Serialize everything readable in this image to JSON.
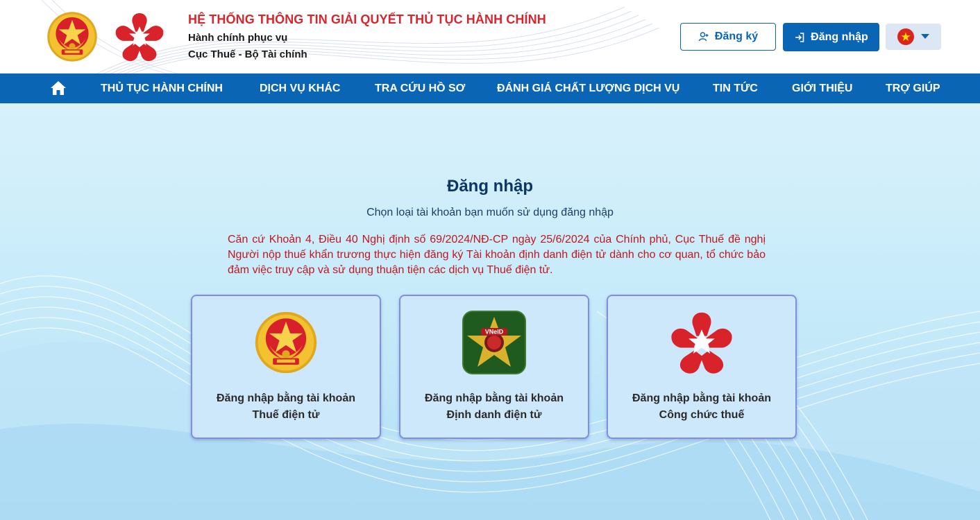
{
  "header": {
    "system_title": "HỆ THỐNG THÔNG TIN GIẢI QUYẾT THỦ TỤC HÀNH CHÍNH",
    "subtitle_line1": "Hành chính phục vụ",
    "subtitle_line2": "Cục Thuế - Bộ Tài chính",
    "register_label": "Đăng ký",
    "login_label": "Đăng nhập",
    "language_icon": "vietnam-flag-icon"
  },
  "nav": {
    "home_icon": "home-icon",
    "items": [
      {
        "label": "THỦ TỤC HÀNH CHÍNH"
      },
      {
        "label": "DỊCH VỤ KHÁC"
      },
      {
        "label": "TRA CỨU HỒ SƠ"
      },
      {
        "label": "ĐÁNH GIÁ CHẤT LƯỢNG DỊCH VỤ"
      },
      {
        "label": "TIN TỨC"
      },
      {
        "label": "GIỚI THIỆU"
      },
      {
        "label": "TRỢ GIÚP"
      }
    ]
  },
  "login": {
    "title": "Đăng nhập",
    "subtitle": "Chọn loại tài khoản bạn muốn sử dụng đăng nhập",
    "notice": "Căn cứ Khoản 4, Điều 40 Nghị định số 69/2024/NĐ-CP ngày 25/6/2024 của Chính phủ, Cục Thuế đề nghị Người nộp thuế khẩn trương thực hiện đăng ký Tài khoản định danh điện tử dành cho cơ quan, tổ chức bảo đảm việc truy cập và sử dụng thuận tiện các dịch vụ Thuế điện tử.",
    "options": [
      {
        "line1": "Đăng nhập bằng tài khoản",
        "line2": "Thuế điện tử",
        "icon": "national-emblem-icon"
      },
      {
        "line1": "Đăng nhập bằng tài khoản",
        "line2": "Định danh điện tử",
        "icon": "vneid-icon",
        "icon_text": "VNeID"
      },
      {
        "line1": "Đăng nhập bằng tài khoản",
        "line2": "Công chức thuế",
        "icon": "public-service-star-icon"
      }
    ]
  },
  "colors": {
    "brand_blue": "#0a66b5",
    "title_red": "#d7262d",
    "notice_red": "#c0171f",
    "card_bg": "#cde7fb",
    "card_border": "#7f8fe0"
  }
}
